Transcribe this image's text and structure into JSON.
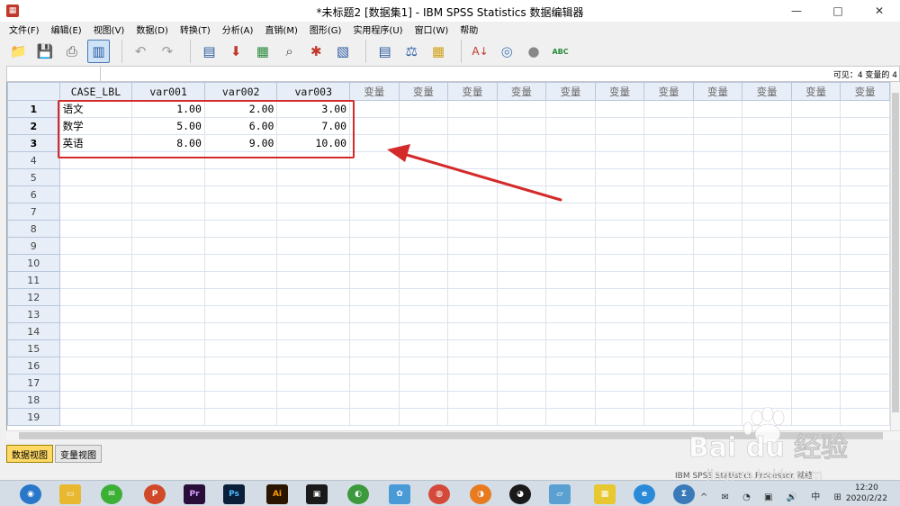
{
  "window": {
    "title": "*未标题2 [数据集1] - IBM SPSS Statistics 数据编辑器",
    "minimize": "—",
    "maximize": "□",
    "close": "✕"
  },
  "menu": [
    "文件(F)",
    "编辑(E)",
    "视图(V)",
    "数据(D)",
    "转换(T)",
    "分析(A)",
    "直销(M)",
    "图形(G)",
    "实用程序(U)",
    "窗口(W)",
    "帮助"
  ],
  "toolbar": {
    "icons": [
      "open-folder-icon",
      "save-icon",
      "print-icon",
      "dialog-recall-icon",
      "undo-icon",
      "redo-icon",
      "goto-case-icon",
      "goto-variable-icon",
      "variables-icon",
      "find-icon",
      "insert-cases-icon",
      "insert-variable-icon",
      "split-file-icon",
      "weight-cases-icon",
      "select-cases-icon",
      "value-labels-icon",
      "use-sets-icon",
      "show-all-variables-icon",
      "spell-check-icon"
    ],
    "spell_label": "ABC"
  },
  "cellbar": {
    "visible_text": "可见：4 变量的 4"
  },
  "grid": {
    "columns": [
      "CASE_LBL",
      "var001",
      "var002",
      "var003",
      "变量",
      "变量",
      "变量",
      "变量",
      "变量",
      "变量",
      "变量",
      "变量",
      "变量",
      "变量",
      "变量"
    ],
    "rows": [
      {
        "num": "1",
        "cells": [
          "语文",
          "1.00",
          "2.00",
          "3.00"
        ]
      },
      {
        "num": "2",
        "cells": [
          "数学",
          "5.00",
          "6.00",
          "7.00"
        ]
      },
      {
        "num": "3",
        "cells": [
          "英语",
          "8.00",
          "9.00",
          "10.00"
        ]
      }
    ],
    "empty_rows": [
      "4",
      "5",
      "6",
      "7",
      "8",
      "9",
      "10",
      "11",
      "12",
      "13",
      "14",
      "15",
      "16",
      "17",
      "18",
      "19"
    ]
  },
  "tabs": {
    "data_view": "数据视图",
    "variable_view": "变量视图"
  },
  "status": {
    "processor": "IBM SPSS Statistics Processor 就绪"
  },
  "taskbar": {
    "time": "12:20",
    "date": "2020/2/22",
    "tray": "^ ✉ ◔ ▣ 🔊 中 ⊞",
    "app_labels": [
      "P",
      "Pr",
      "Ps",
      "Ai"
    ]
  },
  "watermark": {
    "brand": "Bai du 经验",
    "url": "jingyan.baidu.com"
  },
  "colors": {
    "annotation": "#d42a2a",
    "active_tab": "#ffd966",
    "header_bg": "#e8eef7"
  }
}
